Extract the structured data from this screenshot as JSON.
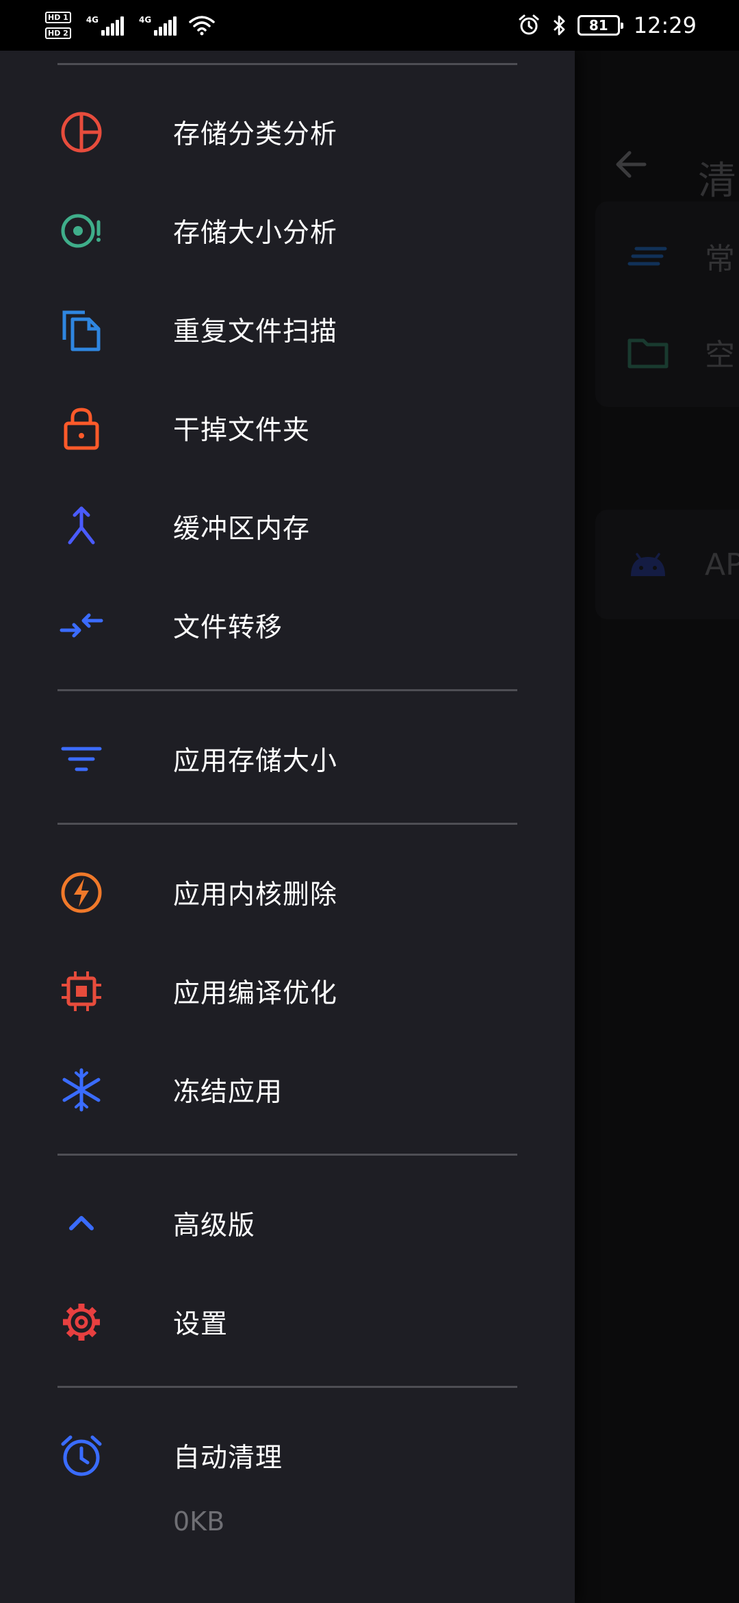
{
  "status_bar": {
    "sim1": "HD 1",
    "sim2": "HD 2",
    "net1": "4G",
    "net2": "4G",
    "battery": "81",
    "time": "12:29"
  },
  "background": {
    "title": "清",
    "rows": [
      {
        "label": "常"
      },
      {
        "label": "空"
      },
      {
        "label": "AP"
      }
    ]
  },
  "drawer": {
    "group1": [
      {
        "label": "存储分类分析",
        "icon": "pie-chart-icon",
        "color": "#e74c3c"
      },
      {
        "label": "存储大小分析",
        "icon": "target-alert-icon",
        "color": "#3fae8a"
      },
      {
        "label": "重复文件扫描",
        "icon": "copy-files-icon",
        "color": "#2f86e0"
      },
      {
        "label": "干掉文件夹",
        "icon": "lock-icon",
        "color": "#ff5a2a"
      },
      {
        "label": "缓冲区内存",
        "icon": "merge-icon",
        "color": "#4a5bff"
      },
      {
        "label": "文件转移",
        "icon": "swap-arrows-icon",
        "color": "#3b6cff"
      }
    ],
    "group2": [
      {
        "label": "应用存储大小",
        "icon": "filter-icon",
        "color": "#3c6cff"
      }
    ],
    "group3": [
      {
        "label": "应用内核删除",
        "icon": "bolt-circle-icon",
        "color": "#f0792a"
      },
      {
        "label": "应用编译优化",
        "icon": "chip-icon",
        "color": "#e74c3c"
      },
      {
        "label": "冻结应用",
        "icon": "snowflake-icon",
        "color": "#3a6cff"
      }
    ],
    "group4": [
      {
        "label": "高级版",
        "icon": "chevron-up-icon",
        "color": "#3a6cff"
      },
      {
        "label": "设置",
        "icon": "gear-icon",
        "color": "#e84040"
      }
    ],
    "group5": [
      {
        "label": "自动清理",
        "icon": "alarm-clock-icon",
        "color": "#3a6cff"
      }
    ],
    "size_text": "0KB"
  }
}
